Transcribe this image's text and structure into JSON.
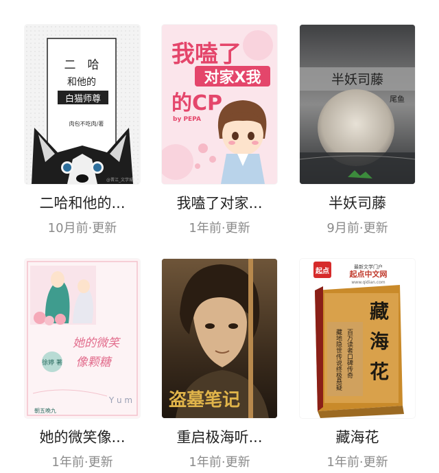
{
  "books": [
    {
      "title": "二哈和他的...",
      "update": "10月前·更新",
      "cover": {
        "line1": "二　哈",
        "line2": "和他的",
        "line3": "白猫师尊",
        "author": "肉包不吃肉/著",
        "watermark": "@晋江_文学城"
      }
    },
    {
      "title": "我嗑了对家...",
      "update": "1年前·更新",
      "cover": {
        "big1": "我嗑了",
        "big2": "对家X我",
        "big3": "的CP",
        "byline": "by PEPA"
      }
    },
    {
      "title": "半妖司藤",
      "update": "9月前·更新",
      "cover": {
        "title": "半妖司藤",
        "author": "尾鱼"
      }
    },
    {
      "title": "她的微笑像...",
      "update": "1年前·更新",
      "cover": {
        "script1": "她的微笑",
        "script2": "像颗糖",
        "author": "徐婷 著",
        "yum": "Y u m",
        "publisher": "朝五晚九"
      }
    },
    {
      "title": "重启极海听...",
      "update": "1年前·更新",
      "cover": {
        "title": "盗墓笔记"
      }
    },
    {
      "title": "藏海花",
      "update": "1年前·更新",
      "cover": {
        "badge": "起点",
        "site": "起点中文网",
        "site_sub": "最新文学门户",
        "url": "www.qidian.com",
        "title": "藏海花",
        "vert1": "藏地隐世传说终极悬疑",
        "vert2": "百万读者口碑传奇"
      }
    }
  ],
  "colors": {
    "title_text": "#222222",
    "update_text": "#8a8a8a",
    "pink_title": "#e4466b"
  }
}
